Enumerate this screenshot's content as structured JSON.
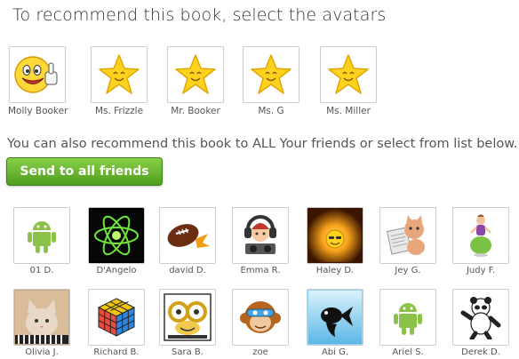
{
  "heading": "To recommend this book, select the avatars",
  "teachers": [
    {
      "name": "Molly Booker",
      "icon": "smiley-thumbs-up-icon"
    },
    {
      "name": "Ms. Frizzle",
      "icon": "star-icon"
    },
    {
      "name": "Mr. Booker",
      "icon": "star-icon"
    },
    {
      "name": "Ms. G",
      "icon": "star-icon"
    },
    {
      "name": "Ms. Miller",
      "icon": "star-icon"
    }
  ],
  "subheading": "You can also recommend this book to ALL Your friends or select from list below.",
  "send_all_label": "Send to all friends",
  "friends": [
    {
      "name": "01 D.",
      "icon": "android-robot-icon"
    },
    {
      "name": "D'Angelo",
      "icon": "atom-icon"
    },
    {
      "name": "david D.",
      "icon": "football-icon"
    },
    {
      "name": "Emma R.",
      "icon": "dj-character-icon"
    },
    {
      "name": "Haley D.",
      "icon": "sun-face-icon"
    },
    {
      "name": "Jey G.",
      "icon": "cat-newspaper-icon"
    },
    {
      "name": "Judy F.",
      "icon": "bouncer-kid-icon"
    },
    {
      "name": "Olivia J.",
      "icon": "cat-photo-icon"
    },
    {
      "name": "Richard B.",
      "icon": "rubiks-cube-icon"
    },
    {
      "name": "Sara B.",
      "icon": "goggles-face-icon"
    },
    {
      "name": "zoe",
      "icon": "monkey-face-icon"
    },
    {
      "name": "Abi G.",
      "icon": "black-fish-icon"
    },
    {
      "name": "Ariel S.",
      "icon": "android-robot-icon"
    },
    {
      "name": "Derek D.",
      "icon": "kung-fu-panda-icon"
    }
  ]
}
